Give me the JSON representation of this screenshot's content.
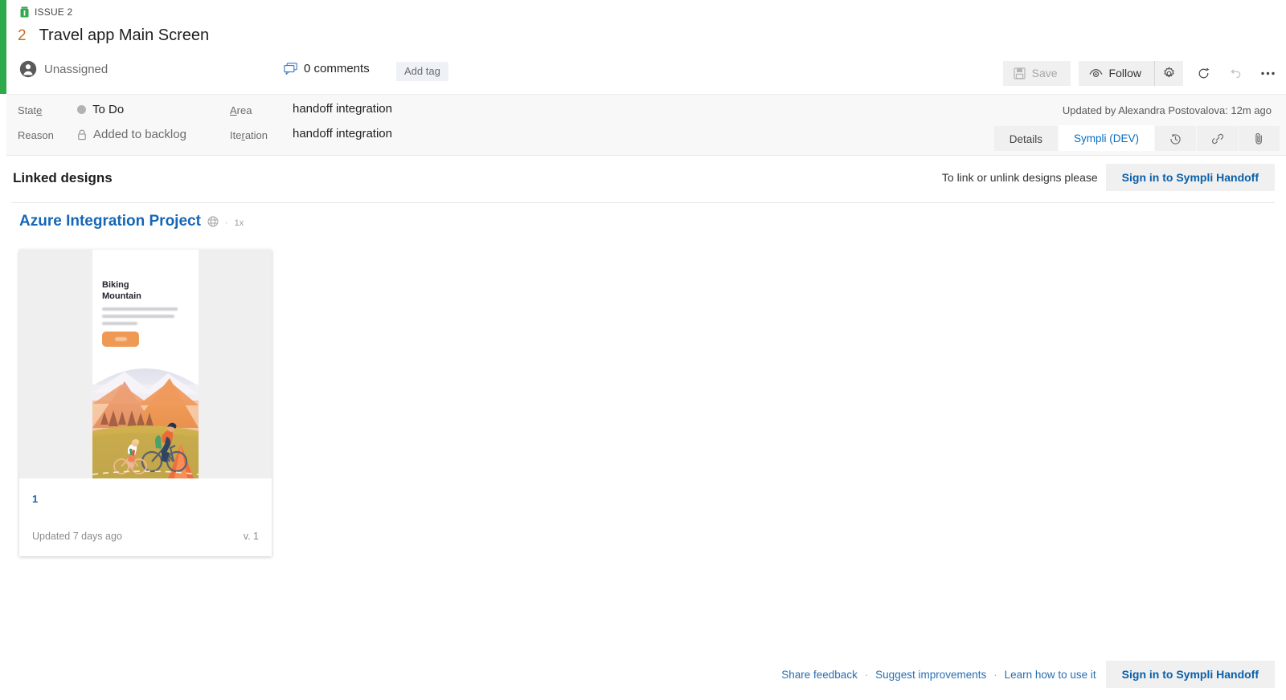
{
  "header": {
    "issue_type": "ISSUE 2",
    "issue_type_icon": "issue-icon",
    "issue_id": "2",
    "issue_title": "Travel app Main Screen",
    "assignee": "Unassigned",
    "assignee_icon": "avatar-icon",
    "comments": "0 comments",
    "comments_icon": "comment-icon",
    "add_tag": "Add tag"
  },
  "toolbar": {
    "save_label": "Save",
    "save_icon": "save-disk-icon",
    "follow_label": "Follow",
    "follow_icon": "eye-icon",
    "gear_icon": "gear-icon",
    "refresh_icon": "refresh-icon",
    "undo_icon": "undo-icon",
    "more_icon": "ellipsis-icon"
  },
  "fields": {
    "state_label": "State",
    "state_label_pre": "Stat",
    "state_label_key": "e",
    "state_value": "To Do",
    "reason_label": "Reason",
    "reason_value": "Added to backlog",
    "reason_icon": "lock-icon",
    "area_label_key": "A",
    "area_label_post": "rea",
    "area_value": "handoff integration",
    "iteration_label_pre": "Ite",
    "iteration_label_key": "r",
    "iteration_label_post": "ation",
    "iteration_value": "handoff integration",
    "updated_by": "Updated by Alexandra Postovalova: 12m ago"
  },
  "tabs": [
    {
      "label": "Details",
      "active": false,
      "icon": ""
    },
    {
      "label": "Sympli (DEV)",
      "active": true,
      "icon": ""
    },
    {
      "label": "",
      "active": false,
      "icon": "history-icon"
    },
    {
      "label": "",
      "active": false,
      "icon": "link-icon"
    },
    {
      "label": "",
      "active": false,
      "icon": "attachment-icon"
    }
  ],
  "section": {
    "title": "Linked designs",
    "signin_hint": "To link or unlink designs please",
    "signin_button": "Sign in to Sympli Handoff"
  },
  "project": {
    "name": "Azure Integration Project",
    "globe_icon": "globe-icon",
    "separator": "·",
    "scale": "1x"
  },
  "design_card": {
    "title": "1",
    "updated": "Updated 7 days ago",
    "version": "v. 1",
    "mockup": {
      "heading_line1": "Biking",
      "heading_line2": "Mountain",
      "body_text": "A bad day on a mountain bike always beats a good day in the office"
    }
  },
  "footer": {
    "links": [
      "Share feedback",
      "Suggest improvements",
      "Learn how to use it"
    ],
    "separator": "·",
    "signin_button": "Sign in to Sympli Handoff"
  },
  "colors": {
    "accent_green": "#2faa4a",
    "link_blue": "#1567b5",
    "active_tab_blue": "#0a6cbf",
    "issue_id_orange": "#c96a1f",
    "band_grey": "#f8f8f8"
  }
}
